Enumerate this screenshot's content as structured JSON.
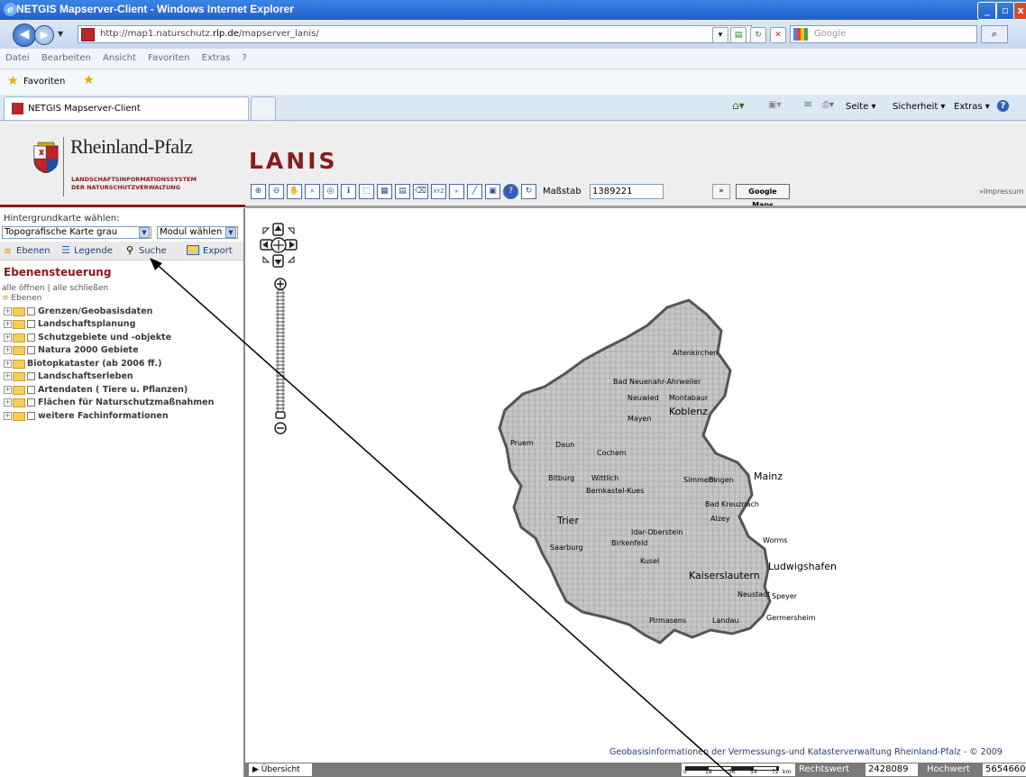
{
  "browser": {
    "window_title": "NETGIS Mapserver-Client - Windows Internet Explorer",
    "url_prefix": "http://map1.naturschutz.",
    "url_host": "rlp.de",
    "url_suffix": "/mapserver_lanis/",
    "search_placeholder": "Google",
    "menu": [
      "Datei",
      "Bearbeiten",
      "Ansicht",
      "Favoriten",
      "Extras",
      "?"
    ],
    "favorites_label": "Favoriten",
    "tab_label": "NETGIS Mapserver-Client",
    "command_bar": [
      "Seite",
      "Sicherheit",
      "Extras"
    ]
  },
  "header": {
    "brand": "Rheinland-Pfalz",
    "brand_sub1": "LANDSCHAFTSINFORMATIONSSYSTEM",
    "brand_sub2": "DER NATURSCHUTZVERWALTUNG",
    "app_title": "LANIS",
    "scale_label": "Maßstab",
    "scale_value": "1389221",
    "go_button": "»",
    "google_maps_button": "Google Maps",
    "impressum": "»Impressum"
  },
  "sidebar": {
    "background_label": "Hintergrundkarte wählen:",
    "background_value": "Topografische Karte grau",
    "module_value": "Modul wählen",
    "tabs": [
      "Ebenen",
      "Legende",
      "Suche",
      "Export"
    ],
    "section_title": "Ebenensteuerung",
    "open_all": "alle öffnen",
    "separator": "|",
    "close_all": "alle schließen",
    "root_label": "Ebenen",
    "layers": [
      {
        "label": "Grenzen/Geobasisdaten",
        "checkbox": true
      },
      {
        "label": "Landschaftsplanung",
        "checkbox": true
      },
      {
        "label": "Schutzgebiete und -objekte",
        "checkbox": true
      },
      {
        "label": "Natura 2000 Gebiete",
        "checkbox": true
      },
      {
        "label": "Biotopkataster (ab 2006 ff.)",
        "checkbox": false
      },
      {
        "label": "Landschaftserleben",
        "checkbox": true
      },
      {
        "label": "Artendaten ( Tiere u. Pflanzen)",
        "checkbox": true
      },
      {
        "label": "Flächen für Naturschutzmaßnahmen",
        "checkbox": true
      },
      {
        "label": "weitere Fachinformationen",
        "checkbox": true
      }
    ]
  },
  "map": {
    "cities": [
      "Altenkirchen",
      "Bad Neuenahr-Ahrweiler",
      "Neuwied",
      "Montabaur",
      "Koblenz",
      "Mayen",
      "Pruem",
      "Daun",
      "Cochem",
      "Bitburg",
      "Wittlich",
      "Bernkastel-Kues",
      "Simmern",
      "Bingen",
      "Mainz",
      "Bad Kreuznach",
      "Alzey",
      "Trier",
      "Idar-Oberstein",
      "Birkenfeld",
      "Saarburg",
      "Worms",
      "Kusel",
      "Kaiserslautern",
      "Ludwigshafen",
      "Neustadt",
      "Speyer",
      "Germersheim",
      "Pirmasens",
      "Landau"
    ],
    "attribution": "Geobasisinformationen der Vermessungs-und Katasterverwaltung Rheinland-Pfalz - © 2009",
    "overview_label": "▶ Übersicht",
    "scalebar_ticks": [
      "0",
      "18",
      "36",
      "54",
      "72"
    ],
    "scalebar_unit": "km",
    "rechtswert_label": "Rechtswert",
    "rechtswert_value": "2428089",
    "hochwert_label": "Hochwert",
    "hochwert_value": "5654660"
  },
  "toolbar_icons": [
    "zoom-in-icon",
    "zoom-out-icon",
    "pan-icon",
    "zoom-box-icon",
    "zoom-full-icon",
    "query-icon",
    "select-icon",
    "select-area-icon",
    "table-icon",
    "erase-icon",
    "coordinate-icon",
    "link-icon",
    "measure-icon",
    "print-icon",
    "help-icon",
    "refresh-icon"
  ],
  "colors": {
    "brand_red": "#8b1a1a",
    "lanis_red": "#8b1a1a",
    "ie_blue": "#1f5fcf"
  }
}
